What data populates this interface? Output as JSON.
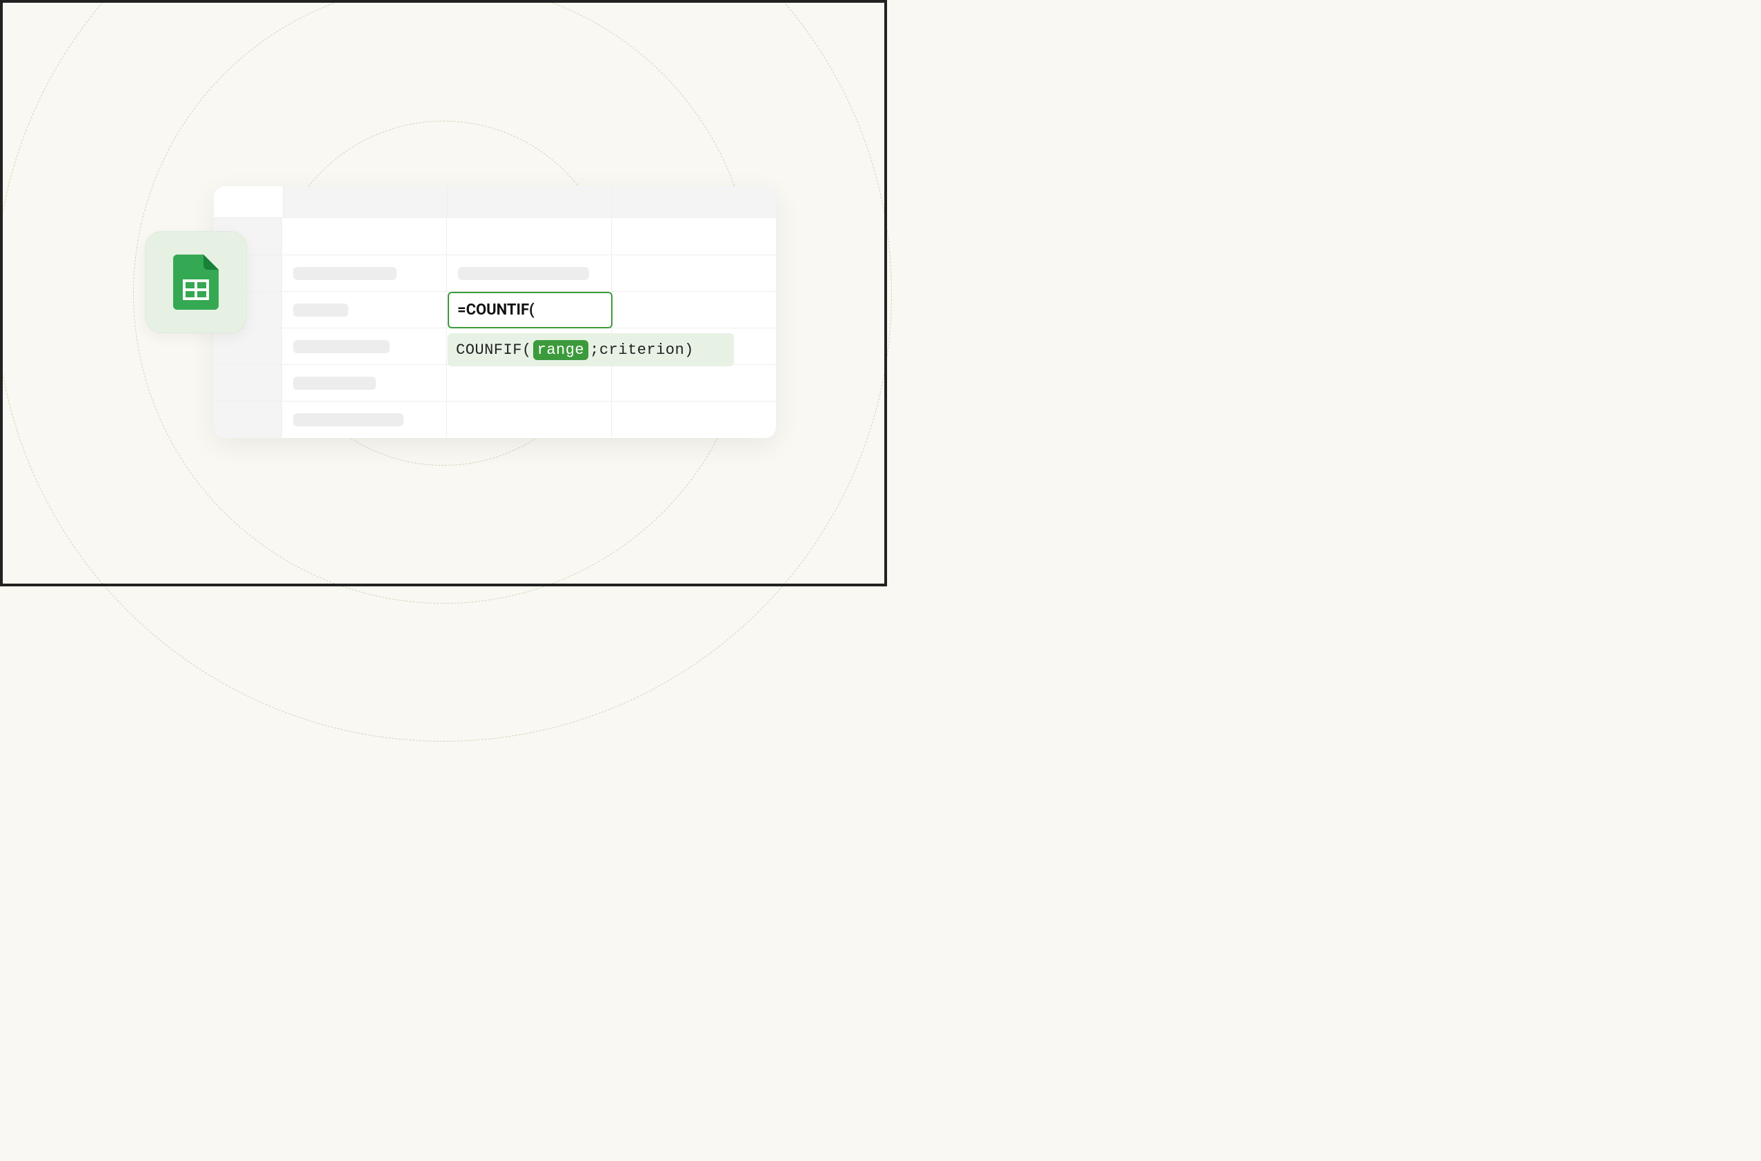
{
  "formula": {
    "active_cell_text": "=COUNTIF(",
    "hint_prefix": "COUNFIF(",
    "hint_highlight": "range",
    "hint_suffix": ";criterion)"
  },
  "icon": {
    "name": "google-sheets-icon"
  }
}
